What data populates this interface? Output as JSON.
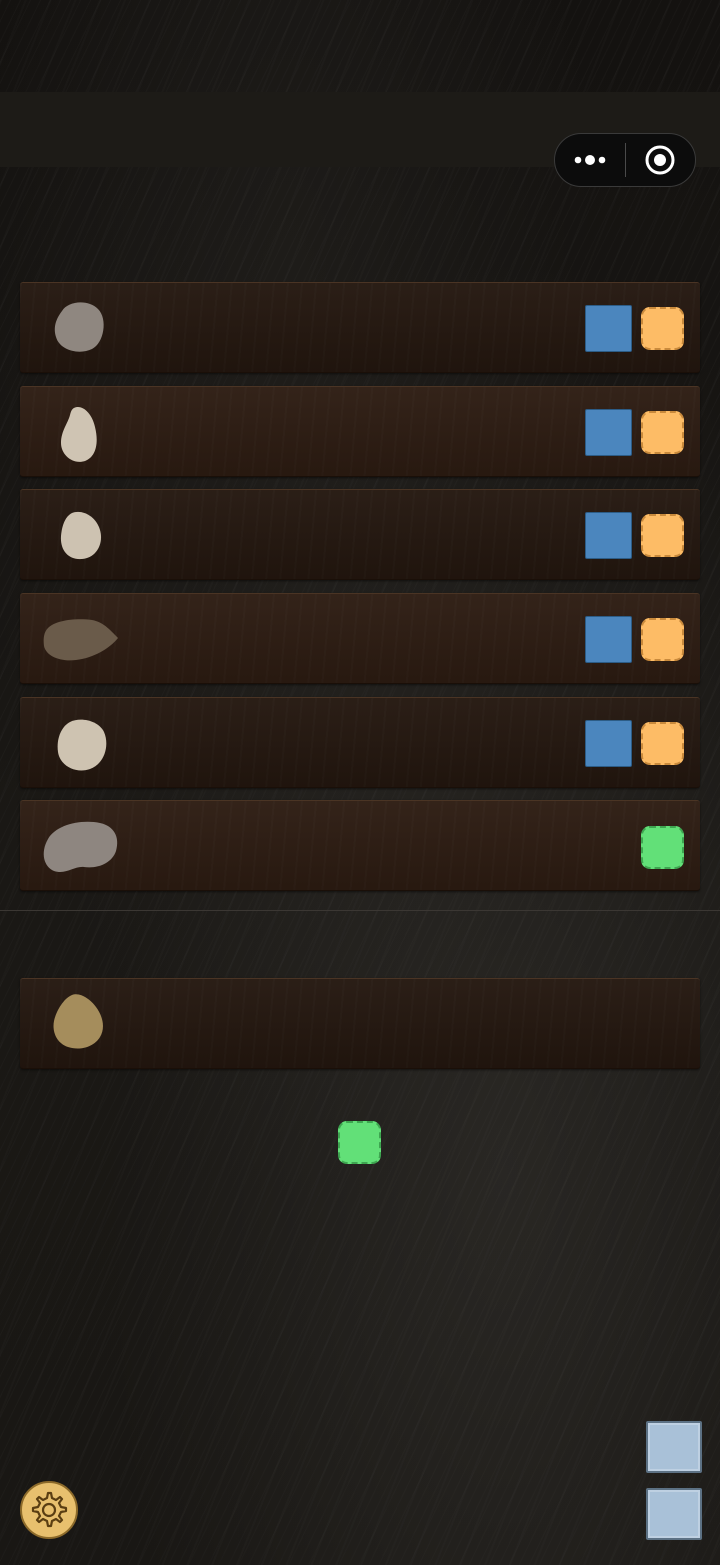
{
  "header": {
    "menu_icon": "more-dots-icon",
    "close_icon": "target-circle-icon"
  },
  "colors": {
    "background": "#151310",
    "row_wood": "#2d1c12",
    "blue_tile": "#4b86be",
    "orange_tile": "#fdbc66",
    "green_tile": "#62e078",
    "side_button": "#a9c1d8",
    "gear_button": "#e8c06e"
  },
  "rows": [
    {
      "stone": "gray-round-stone",
      "tiles": [
        "blue-tile",
        "orange-tile"
      ]
    },
    {
      "stone": "pale-oval-stone",
      "tiles": [
        "blue-tile",
        "orange-tile"
      ]
    },
    {
      "stone": "pale-round-stone",
      "tiles": [
        "blue-tile",
        "orange-tile"
      ]
    },
    {
      "stone": "brown-flat-stone",
      "tiles": [
        "blue-tile",
        "orange-tile"
      ]
    },
    {
      "stone": "pale-large-stone",
      "tiles": [
        "blue-tile",
        "orange-tile"
      ]
    },
    {
      "stone": "gray-wide-stone",
      "tiles": [
        "green-tile"
      ]
    }
  ],
  "selected_row": {
    "stone": "gold-stone",
    "tiles": []
  },
  "action_tile": "green-tile",
  "footer": {
    "settings_icon": "gear-icon",
    "side_buttons": [
      "side-button-1",
      "side-button-2"
    ]
  }
}
